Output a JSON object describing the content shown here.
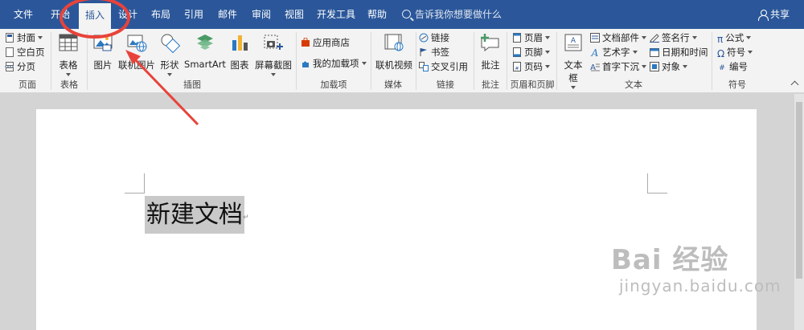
{
  "tabs": [
    {
      "label": "文件"
    },
    {
      "label": "开始"
    },
    {
      "label": "插入",
      "active": true
    },
    {
      "label": "设计"
    },
    {
      "label": "布局"
    },
    {
      "label": "引用"
    },
    {
      "label": "邮件"
    },
    {
      "label": "审阅"
    },
    {
      "label": "视图"
    },
    {
      "label": "开发工具"
    },
    {
      "label": "帮助"
    }
  ],
  "tell_me": "告诉我你想要做什么",
  "share": "共享",
  "ribbon": {
    "pages": {
      "label": "页面",
      "cover": "封面",
      "blank": "空白页",
      "break": "分页"
    },
    "table": {
      "label": "表格",
      "button": "表格"
    },
    "illustrations": {
      "label": "插图",
      "picture": "图片",
      "online_picture": "联机图片",
      "shapes": "形状",
      "smartart": "SmartArt",
      "chart": "图表",
      "screenshot": "屏幕截图"
    },
    "addins": {
      "label": "加载项",
      "store": "应用商店",
      "my_addins": "我的加载项"
    },
    "media": {
      "label": "媒体",
      "online_video": "联机视频"
    },
    "links": {
      "label": "链接",
      "link": "链接",
      "bookmark": "书签",
      "cross_ref": "交叉引用"
    },
    "comments": {
      "label": "批注",
      "comment": "批注"
    },
    "header_footer": {
      "label": "页眉和页脚",
      "header": "页眉",
      "footer": "页脚",
      "page_number": "页码"
    },
    "text": {
      "label": "文本",
      "textbox": "文本框",
      "quick_parts": "文档部件",
      "wordart": "艺术字",
      "dropcap": "首字下沉",
      "signature": "签名行",
      "datetime": "日期和时间",
      "object": "对象"
    },
    "symbols": {
      "label": "符号",
      "equation": "公式",
      "symbol": "符号",
      "number": "编号"
    }
  },
  "document": {
    "text": "新建文档"
  },
  "watermark": {
    "brand": "Bai 经验",
    "url": "jingyan.baidu.com"
  },
  "colors": {
    "titlebar": "#2b579a",
    "ribbon_bg": "#f3f3f3",
    "annotation": "#e8433a"
  }
}
